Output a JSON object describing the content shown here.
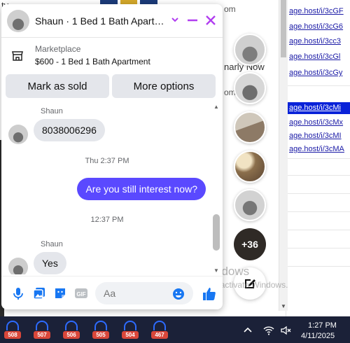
{
  "background": {
    "fragments": [
      "tv",
      "om",
      "narly Now",
      "om"
    ],
    "links": [
      "age.host/i/3cGF",
      "age.host/i/3cG6",
      "age.host/i/3cc3",
      "age.host/i/3cGl",
      "age.host/i/3cGy",
      "age.host/i/3cMi",
      "age.host/i/3cMx",
      "age.host/i/3cMI",
      "age.host/i/3cMA"
    ],
    "selected_link_index": 5
  },
  "chat": {
    "title": "Shaun · 1 Bed 1 Bath Apart…",
    "listing": {
      "category": "Marketplace",
      "title": "$600 - 1 Bed 1 Bath Apartment",
      "mark_sold_label": "Mark as sold",
      "more_options_label": "More options"
    },
    "messages": {
      "sender1": "Shaun",
      "msg1": "8038006296",
      "ts1": "Thu 2:37 PM",
      "msg2": "Are you still interest now?",
      "ts2": "12:37 PM",
      "sender2": "Shaun",
      "msg3": "Yes"
    },
    "input_placeholder": "Aa"
  },
  "chat_heads": {
    "more_count": "+36"
  },
  "watermark": {
    "title": "Activate Windows",
    "subtitle": "Go to Settings to activate Windows."
  },
  "taskbar": {
    "badges": [
      "508",
      "507",
      "506",
      "505",
      "504",
      "467"
    ],
    "time": "1:27 PM",
    "date": "4/11/2025"
  },
  "colors": {
    "accent": "#5a49ff",
    "header_icons": "#b13ef0",
    "selected_link": "#0a23d8",
    "taskbar": "#1b2138"
  }
}
